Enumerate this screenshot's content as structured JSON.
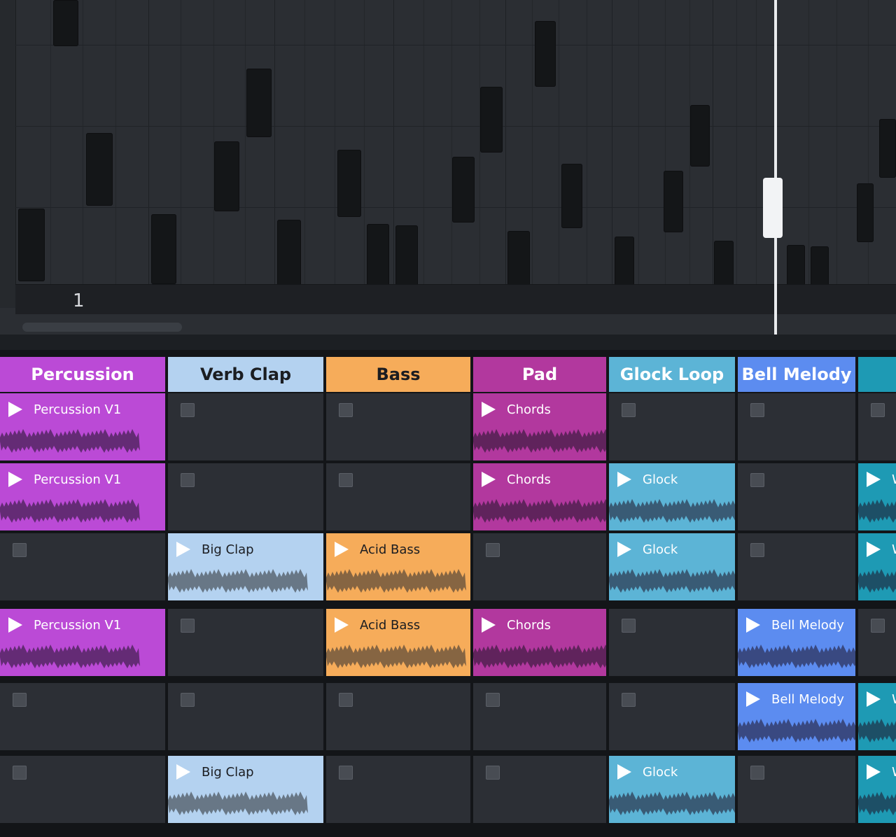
{
  "piano_roll": {
    "bar_number": "1"
  },
  "colors": {
    "percussion": "#bb4ad6",
    "verb_clap": "#b4d2f0",
    "bass": "#f6ac5a",
    "pad": "#b2389e",
    "glock": "#5cb4d6",
    "bell": "#5c8cf0",
    "teal": "#1e9ab4"
  },
  "tracks": [
    {
      "name": "Percussion",
      "color_key": "percussion",
      "text_color": "#ffffff"
    },
    {
      "name": "Verb Clap",
      "color_key": "verb_clap",
      "text_color": "#1b1d21"
    },
    {
      "name": "Bass",
      "color_key": "bass",
      "text_color": "#1b1d21"
    },
    {
      "name": "Pad",
      "color_key": "pad",
      "text_color": "#ffffff"
    },
    {
      "name": "Glock Loop",
      "color_key": "glock",
      "text_color": "#ffffff"
    },
    {
      "name": "Bell Melody",
      "color_key": "bell",
      "text_color": "#ffffff"
    },
    {
      "name": "",
      "color_key": "teal",
      "text_color": "#ffffff"
    }
  ],
  "clips": [
    {
      "track": 0,
      "scene": 0,
      "name": "Percussion V1"
    },
    {
      "track": 0,
      "scene": 1,
      "name": "Percussion V1"
    },
    {
      "track": 0,
      "scene": 3,
      "name": "Percussion V1"
    },
    {
      "track": 1,
      "scene": 2,
      "name": "Big Clap"
    },
    {
      "track": 1,
      "scene": 5,
      "name": "Big Clap"
    },
    {
      "track": 2,
      "scene": 2,
      "name": "Acid Bass"
    },
    {
      "track": 2,
      "scene": 3,
      "name": "Acid Bass"
    },
    {
      "track": 3,
      "scene": 0,
      "name": "Chords"
    },
    {
      "track": 3,
      "scene": 1,
      "name": "Chords"
    },
    {
      "track": 3,
      "scene": 3,
      "name": "Chords"
    },
    {
      "track": 4,
      "scene": 1,
      "name": "Glock"
    },
    {
      "track": 4,
      "scene": 2,
      "name": "Glock"
    },
    {
      "track": 4,
      "scene": 5,
      "name": "Glock"
    },
    {
      "track": 5,
      "scene": 3,
      "name": "Bell Melody"
    },
    {
      "track": 5,
      "scene": 4,
      "name": "Bell Melody"
    },
    {
      "track": 6,
      "scene": 1,
      "name": "W"
    },
    {
      "track": 6,
      "scene": 2,
      "name": "W"
    },
    {
      "track": 6,
      "scene": 4,
      "name": "W"
    },
    {
      "track": 6,
      "scene": 5,
      "name": "W"
    }
  ]
}
